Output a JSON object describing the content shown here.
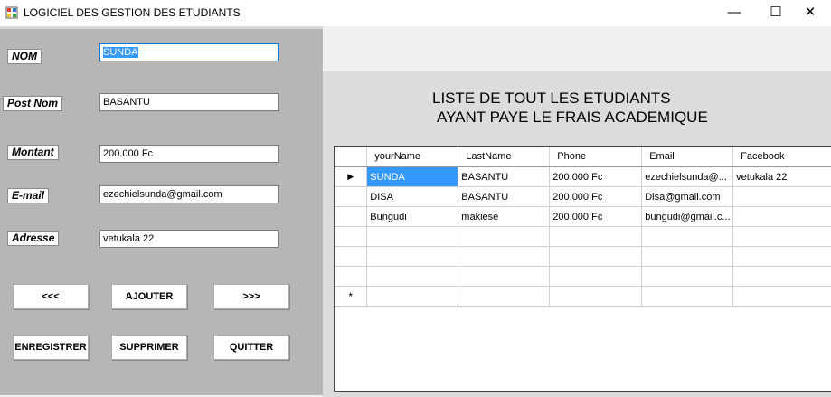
{
  "window": {
    "title": "LOGICIEL DES GESTION DES ETUDIANTS",
    "minimize": "—",
    "maximize": "☐",
    "close": "✕"
  },
  "form": {
    "nom_label": "NOM",
    "nom_value": "SUNDA",
    "postnom_label": "Post Nom",
    "postnom_value": "BASANTU",
    "montant_label": "Montant",
    "montant_value": "200.000 Fc",
    "email_label": "E-mail",
    "email_value": "ezechielsunda@gmail.com",
    "adresse_label": "Adresse",
    "adresse_value": "vetukala 22"
  },
  "buttons": {
    "prev": "<<<",
    "add": "AJOUTER",
    "next": ">>>",
    "save": "ENREGISTRER",
    "delete": "SUPPRIMER",
    "quit": "QUITTER"
  },
  "heading": {
    "line1": "LISTE DE TOUT LES ETUDIANTS",
    "line2": "AYANT PAYE LE FRAIS ACADEMIQUE"
  },
  "grid": {
    "columns": [
      "yourName",
      "LastName",
      "Phone",
      "Email",
      "Facebook"
    ],
    "rows": [
      [
        "SUNDA",
        "BASANTU",
        "200.000 Fc",
        "ezechielsunda@...",
        "vetukala 22"
      ],
      [
        "DISA",
        "BASANTU",
        "200.000 Fc",
        "Disa@gmail.com",
        ""
      ],
      [
        "Bungudi",
        "makiese",
        "200.000 Fc",
        "bungudi@gmail.c...",
        ""
      ],
      [
        "",
        "",
        "",
        "",
        ""
      ],
      [
        "",
        "",
        "",
        "",
        ""
      ],
      [
        "",
        "",
        "",
        "",
        ""
      ],
      [
        "",
        "",
        "",
        "",
        ""
      ]
    ],
    "current_row_marker": "▶",
    "new_row_marker": "*"
  }
}
